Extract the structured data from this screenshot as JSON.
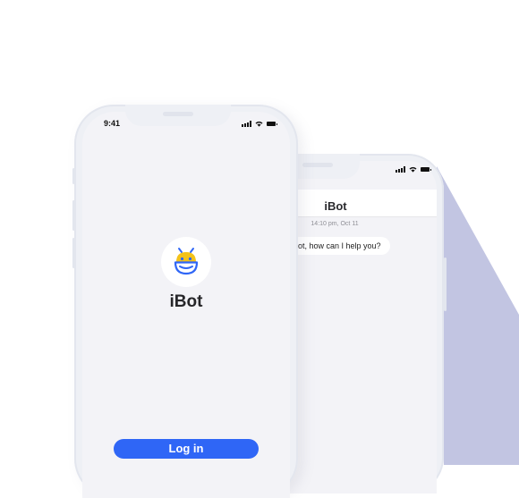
{
  "colors": {
    "accent": "#2f66f6",
    "shadow_shape": "#c2c5e2",
    "logo_yellow": "#f3c21a",
    "logo_blue": "#2f66f6"
  },
  "front_phone": {
    "status_time": "9:41",
    "status_icons": [
      "signal-icon",
      "wifi-icon",
      "battery-icon"
    ],
    "logo_icon": "robot-logo-icon",
    "app_name": "iBot",
    "login_label": "Log in"
  },
  "back_phone": {
    "status_icons": [
      "signal-icon",
      "wifi-icon",
      "battery-icon"
    ],
    "chat_title": "iBot",
    "timestamp": "14:10 pm, Oct 11",
    "message": "is iBot, how can I help you?"
  }
}
